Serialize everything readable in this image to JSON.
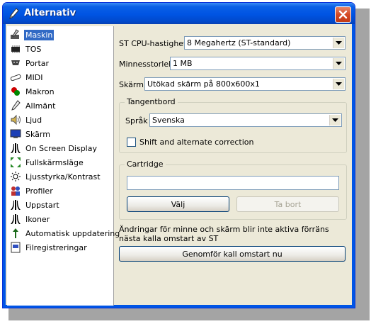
{
  "window": {
    "title": "Alternativ",
    "accent": "#0054e3"
  },
  "sidebar": {
    "items": [
      {
        "label": "Maskin",
        "icon": "computer-pen-icon",
        "selected": true
      },
      {
        "label": "TOS",
        "icon": "chip-icon"
      },
      {
        "label": "Portar",
        "icon": "port-icon"
      },
      {
        "label": "MIDI",
        "icon": "midi-cable-icon"
      },
      {
        "label": "Makron",
        "icon": "macro-icon"
      },
      {
        "label": "Allmänt",
        "icon": "wrench-icon"
      },
      {
        "label": "Ljud",
        "icon": "speaker-icon"
      },
      {
        "label": "Skärm",
        "icon": "monitor-icon"
      },
      {
        "label": "On Screen Display",
        "icon": "atari-logo-icon"
      },
      {
        "label": "Fullskärmsläge",
        "icon": "fullscreen-icon"
      },
      {
        "label": "Ljusstyrka/Kontrast",
        "icon": "brightness-icon"
      },
      {
        "label": "Profiler",
        "icon": "profiles-icon"
      },
      {
        "label": "Uppstart",
        "icon": "atari-logo-icon"
      },
      {
        "label": "Ikoner",
        "icon": "atari-logo-icon"
      },
      {
        "label": "Automatisk uppdatering",
        "icon": "update-icon"
      },
      {
        "label": "Filregistreringar",
        "icon": "file-registration-icon"
      }
    ]
  },
  "main": {
    "cpu": {
      "label": "ST CPU-hastighet",
      "value": "8 Megahertz (ST-standard)"
    },
    "memory": {
      "label": "Minnesstorlek",
      "value": "1 MB"
    },
    "screen": {
      "label": "Skärm",
      "value": "Utökad skärm på 800x600x1"
    },
    "keyboard": {
      "legend": "Tangentbord",
      "language_label": "Språk",
      "language_value": "Svenska",
      "shift_label": "Shift and alternate correction",
      "shift_checked": false
    },
    "cartridge": {
      "legend": "Cartridge",
      "path_value": "",
      "choose_label": "Välj",
      "remove_label": "Ta bort"
    },
    "notice": "Ändringar för minne och skärm blir inte aktiva förräns nästa kalla omstart av ST",
    "restart_label": "Genomför kall omstart nu"
  }
}
